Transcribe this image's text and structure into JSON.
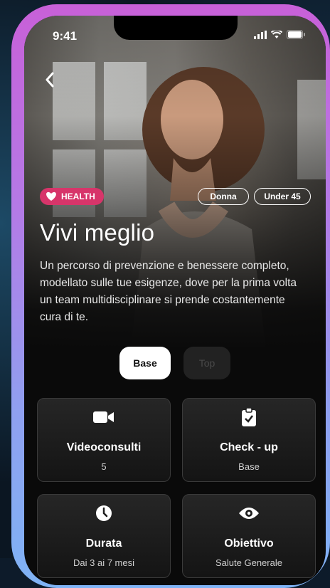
{
  "status_bar": {
    "time": "9:41"
  },
  "tag": {
    "label": "HEALTH"
  },
  "pills": [
    "Donna",
    "Under 45"
  ],
  "title": "Vivi meglio",
  "description": "Un percorso di prevenzione e benessere completo, modellato sulle tue esigenze, dove per la prima volta un team multidisciplinare si prende costantemente cura di te.",
  "plan_toggle": {
    "options": [
      "Base",
      "Top"
    ],
    "selected": "Base"
  },
  "features": [
    {
      "label": "Videoconsulti",
      "value": "5",
      "icon": "video-camera-icon"
    },
    {
      "label": "Check - up",
      "value": "Base",
      "icon": "clipboard-check-icon"
    },
    {
      "label": "Durata",
      "value": "Dai 3 ai 7 mesi",
      "icon": "clock-icon"
    },
    {
      "label": "Obiettivo",
      "value": "Salute Generale",
      "icon": "eye-icon"
    }
  ],
  "colors": {
    "frame_gradient": [
      "#c860d8",
      "#7fb3f5"
    ],
    "health_tag": "#d7356a",
    "background": "#0a0a0a"
  }
}
